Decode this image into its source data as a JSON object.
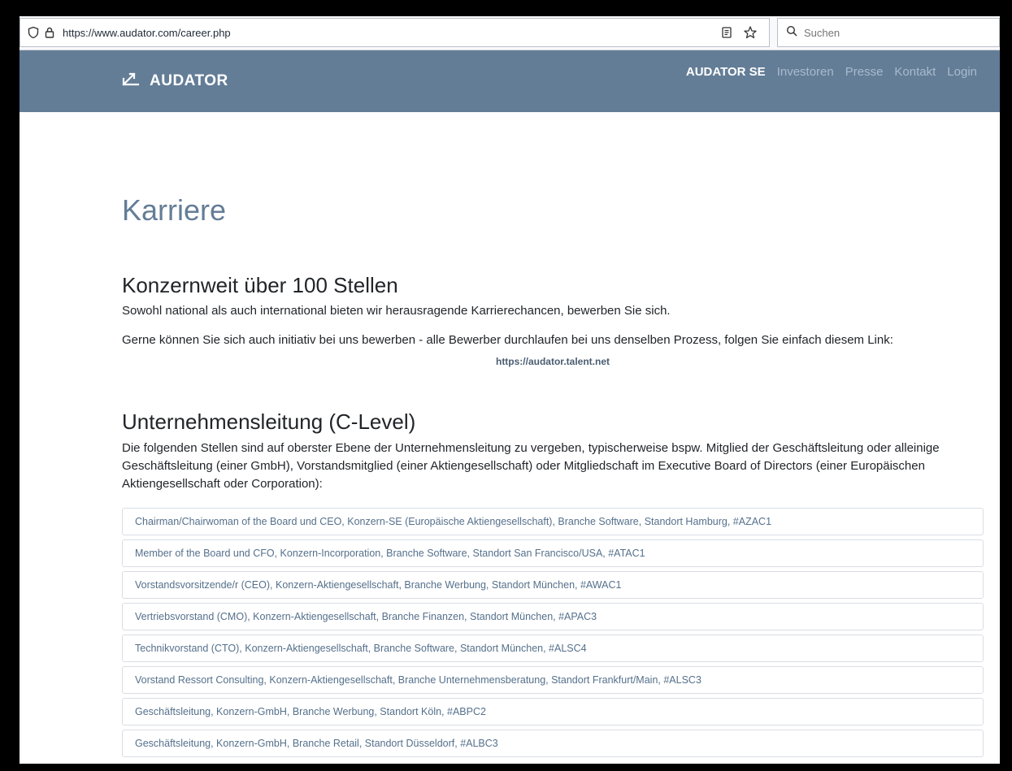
{
  "browser": {
    "url": "https://www.audator.com/career.php",
    "search_placeholder": "Suchen",
    "icons": [
      "shield-icon",
      "lock-icon",
      "reader-mode-icon",
      "bookmark-star-icon",
      "search-icon"
    ]
  },
  "navbar": {
    "brand": "AUDATOR",
    "links": [
      "AUDATOR SE",
      "Investoren",
      "Presse",
      "Kontakt",
      "Login"
    ],
    "accent": "#637d97"
  },
  "page": {
    "title": "Karriere",
    "section1": {
      "heading": "Konzernweit über 100 Stellen",
      "p1": "Sowohl national als auch international bieten wir herausragende Karrierechancen, bewerben Sie sich.",
      "p2": "Gerne können Sie sich auch initiativ bei uns bewerben - alle Bewerber durchlaufen bei uns denselben Prozess, folgen Sie einfach diesem Link:",
      "link": "https://audator.talent.net"
    },
    "section2": {
      "heading": "Unternehmensleitung (C-Level)",
      "intro": "Die folgenden Stellen sind auf oberster Ebene der Unternehmensleitung zu vergeben, typischerweise bspw. Mitglied der Geschäftsleitung oder alleinige Geschäftsleitung (einer GmbH), Vorstandsmitglied (einer Aktiengesellschaft) oder Mitgliedschaft im Executive Board of Directors (einer Europäischen Aktiengesellschaft oder Corporation):"
    },
    "jobs": [
      "Chairman/Chairwoman of the Board und CEO, Konzern-SE (Europäische Aktiengesellschaft), Branche Software, Standort Hamburg, #AZAC1",
      "Member of the Board und CFO, Konzern-Incorporation, Branche Software, Standort San Francisco/USA, #ATAC1",
      "Vorstandsvorsitzende/r (CEO), Konzern-Aktiengesellschaft, Branche Werbung, Standort München, #AWAC1",
      "Vertriebsvorstand (CMO), Konzern-Aktiengesellschaft, Branche Finanzen, Standort München, #APAC3",
      "Technikvorstand (CTO), Konzern-Aktiengesellschaft, Branche Software, Standort München, #ALSC4",
      "Vorstand Ressort Consulting, Konzern-Aktiengesellschaft, Branche Unternehmensberatung, Standort Frankfurt/Main, #ALSC3",
      "Geschäftsleitung, Konzern-GmbH, Branche Werbung, Standort Köln, #ABPC2",
      "Geschäftsleitung, Konzern-GmbH, Branche Retail, Standort Düsseldorf, #ALBC3"
    ]
  }
}
